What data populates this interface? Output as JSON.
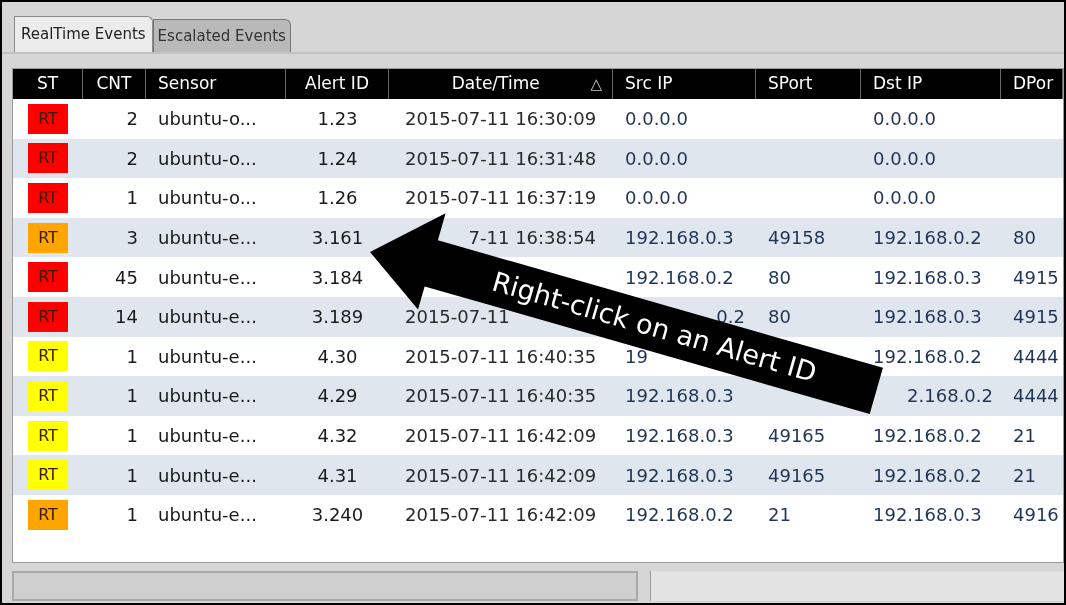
{
  "tabs": [
    {
      "label": "RealTime Events",
      "selected": true
    },
    {
      "label": "Escalated Events",
      "selected": false
    }
  ],
  "table": {
    "columns": [
      "ST",
      "CNT",
      "Sensor",
      "Alert ID",
      "Date/Time",
      "Src IP",
      "SPort",
      "Dst IP",
      "DPor"
    ],
    "sort_indicator": "△",
    "rows": [
      {
        "cells": [
          {
            "text": "RT",
            "color": "#ff0000"
          },
          "2",
          "ubuntu-o...",
          "1.23",
          "2015-07-11 16:30:09",
          "0.0.0.0",
          null,
          "0.0.0.0",
          null
        ]
      },
      {
        "cells": [
          {
            "text": "RT",
            "color": "#ff0000"
          },
          "2",
          "ubuntu-o...",
          "1.24",
          "2015-07-11 16:31:48",
          "0.0.0.0",
          null,
          "0.0.0.0",
          null
        ]
      },
      {
        "cells": [
          {
            "text": "RT",
            "color": "#ff0000"
          },
          "1",
          "ubuntu-o...",
          "1.26",
          "2015-07-11 16:37:19",
          "0.0.0.0",
          null,
          "0.0.0.0",
          null
        ]
      },
      {
        "cells": [
          {
            "text": "RT",
            "color": "#ffa500"
          },
          "3",
          "ubuntu-e...",
          "3.161",
          {
            "text": "7-11 16:38:54",
            "clipped_start": true
          },
          "192.168.0.3",
          "49158",
          "192.168.0.2",
          "80"
        ]
      },
      {
        "cells": [
          {
            "text": "RT",
            "color": "#ff0000"
          },
          "45",
          "ubuntu-e...",
          "3.184",
          null,
          "192.168.0.2",
          "80",
          "192.168.0.3",
          "4915"
        ]
      },
      {
        "cells": [
          {
            "text": "RT",
            "color": "#ff0000"
          },
          "14",
          "ubuntu-e...",
          "3.189",
          "2015-07-11",
          {
            "text": "0.2",
            "clipped_start": true
          },
          "80",
          "192.168.0.3",
          "4915"
        ]
      },
      {
        "cells": [
          {
            "text": "RT",
            "color": "#ffff00"
          },
          "1",
          "ubuntu-e...",
          "4.30",
          "2015-07-11 16:40:35",
          "19",
          null,
          "192.168.0.2",
          "4444"
        ]
      },
      {
        "cells": [
          {
            "text": "RT",
            "color": "#ffff00"
          },
          "1",
          "ubuntu-e...",
          "4.29",
          "2015-07-11 16:40:35",
          "192.168.0.3",
          null,
          {
            "text": "2.168.0.2",
            "clipped_start": true
          },
          "4444"
        ]
      },
      {
        "cells": [
          {
            "text": "RT",
            "color": "#ffff00"
          },
          "1",
          "ubuntu-e...",
          "4.32",
          "2015-07-11 16:42:09",
          "192.168.0.3",
          "49165",
          "192.168.0.2",
          "21"
        ]
      },
      {
        "cells": [
          {
            "text": "RT",
            "color": "#ffff00"
          },
          "1",
          "ubuntu-e...",
          "4.31",
          "2015-07-11 16:42:09",
          "192.168.0.3",
          "49165",
          "192.168.0.2",
          "21"
        ]
      },
      {
        "cells": [
          {
            "text": "RT",
            "color": "#ffa500"
          },
          "1",
          "ubuntu-e...",
          "3.240",
          "2015-07-11 16:42:09",
          "192.168.0.2",
          "21",
          "192.168.0.3",
          "4916"
        ]
      }
    ]
  },
  "callout": {
    "text": "Right-click on an Alert ID"
  }
}
